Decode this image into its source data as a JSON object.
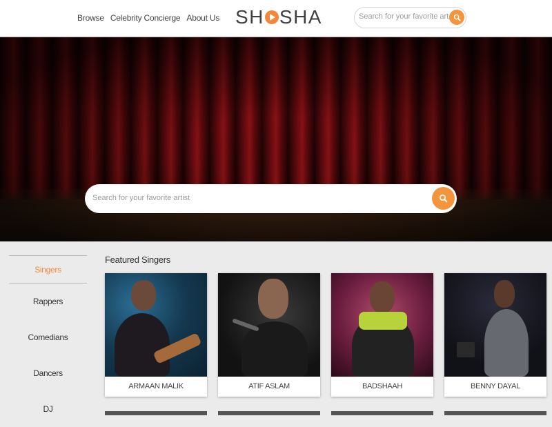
{
  "header": {
    "nav": [
      "Browse",
      "Celebrity Concierge",
      "About Us"
    ],
    "logo_left": "SH",
    "logo_right": "SHA",
    "search_placeholder": "Search for your favorite artist"
  },
  "hero": {
    "search_placeholder": "Search for your favorite artist"
  },
  "sidebar": {
    "active": "Singers",
    "items": [
      "Rappers",
      "Comedians",
      "Dancers",
      "DJ"
    ]
  },
  "featured": {
    "title": "Featured Singers",
    "cards": [
      {
        "name": "ARMAAN MALIK"
      },
      {
        "name": "ATIF ASLAM"
      },
      {
        "name": "BADSHAAH"
      },
      {
        "name": "BENNY DAYAL"
      }
    ]
  },
  "colors": {
    "accent": "#f4943c",
    "active_category": "#f4873a"
  },
  "icons": [
    "search-icon",
    "play-icon"
  ]
}
